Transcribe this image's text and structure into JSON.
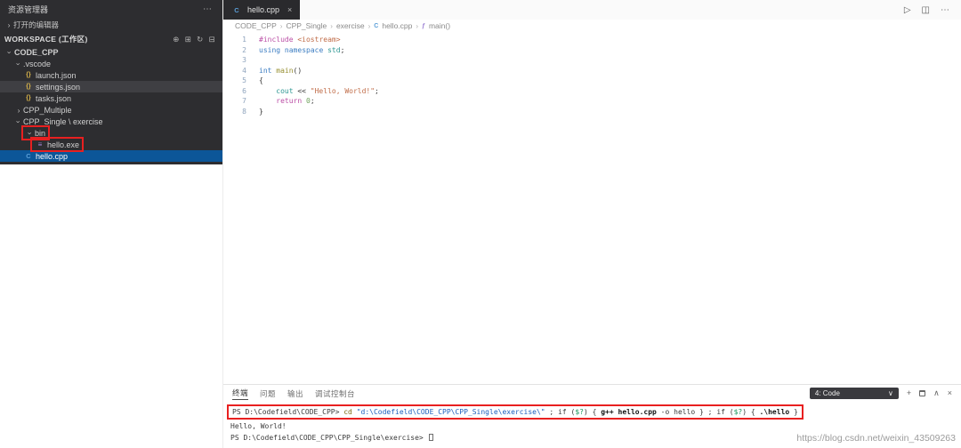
{
  "icons": {
    "more": "⋯",
    "new_file": "⊕",
    "new_folder": "⊞",
    "refresh": "↻",
    "collapse_all": "⊟",
    "chevron_collapsed": "›",
    "run": "▷",
    "split_editor": "◫",
    "close": "×",
    "plus": "+",
    "maximize": "∧",
    "dropdown_chevron": "∨",
    "json_glyph": "{}",
    "cpp_glyph": "C",
    "exe_glyph": "≡",
    "symbol_glyph": "ƒ"
  },
  "colors": {
    "sidebar_bg": "#2d2d30",
    "selection_blue": "#0c5698",
    "selection_gray": "#3f3f43",
    "tab_bg": "#2a2a2d",
    "annotation_red": "#e82020",
    "string_orange": "#c06c48",
    "keyword_pink": "#bb4fa6",
    "keyword_blue": "#3c7dc2"
  },
  "sidebar": {
    "title": "资源管理器",
    "open_editors_label": "打开的编辑器",
    "workspace_label": "WORKSPACE (工作区)",
    "tree": [
      {
        "label": "CODE_CPP",
        "indent": 0,
        "chevron": "down",
        "type": "folder"
      },
      {
        "label": ".vscode",
        "indent": 1,
        "chevron": "down",
        "type": "folder"
      },
      {
        "label": "launch.json",
        "indent": 2,
        "type": "json"
      },
      {
        "label": "settings.json",
        "indent": 2,
        "type": "json",
        "selected": "gray"
      },
      {
        "label": "tasks.json",
        "indent": 2,
        "type": "json"
      },
      {
        "label": "CPP_Multiple",
        "indent": 1,
        "chevron": "right",
        "type": "folder"
      },
      {
        "label": "CPP_Single \\ exercise",
        "indent": 1,
        "chevron": "down",
        "type": "folder"
      },
      {
        "label": "bin",
        "indent": 2,
        "chevron": "down",
        "type": "folder",
        "redbox": true
      },
      {
        "label": "hello.exe",
        "indent": 3,
        "type": "exe",
        "redbox": true
      },
      {
        "label": "hello.cpp",
        "indent": 2,
        "type": "cpp",
        "selected": "blue"
      }
    ]
  },
  "tab": {
    "title": "hello.cpp"
  },
  "breadcrumb": [
    {
      "label": "CODE_CPP"
    },
    {
      "label": "CPP_Single"
    },
    {
      "label": "exercise"
    },
    {
      "label": "hello.cpp",
      "icon": "cpp"
    },
    {
      "label": "main()",
      "icon": "symbol"
    }
  ],
  "code": {
    "lines": [
      {
        "num": "1",
        "tokens": [
          {
            "t": "#include ",
            "c": "pink"
          },
          {
            "t": "<iostream>",
            "c": "orange"
          }
        ]
      },
      {
        "num": "2",
        "tokens": [
          {
            "t": "using",
            "c": "blue"
          },
          {
            "t": " ",
            "c": "fg"
          },
          {
            "t": "namespace",
            "c": "blue"
          },
          {
            "t": " ",
            "c": "fg"
          },
          {
            "t": "std",
            "c": "teal"
          },
          {
            "t": ";",
            "c": "fg"
          }
        ]
      },
      {
        "num": "3",
        "tokens": []
      },
      {
        "num": "4",
        "tokens": [
          {
            "t": "int",
            "c": "blue"
          },
          {
            "t": " ",
            "c": "fg"
          },
          {
            "t": "main",
            "c": "yellow"
          },
          {
            "t": "()",
            "c": "fg"
          }
        ]
      },
      {
        "num": "5",
        "tokens": [
          {
            "t": "{",
            "c": "fg"
          }
        ]
      },
      {
        "num": "6",
        "tokens": [
          {
            "t": "    ",
            "c": "fg"
          },
          {
            "t": "cout",
            "c": "teal"
          },
          {
            "t": " << ",
            "c": "fg"
          },
          {
            "t": "\"Hello, World!\"",
            "c": "orange"
          },
          {
            "t": ";",
            "c": "fg"
          }
        ]
      },
      {
        "num": "7",
        "tokens": [
          {
            "t": "    ",
            "c": "fg"
          },
          {
            "t": "return",
            "c": "pink"
          },
          {
            "t": " ",
            "c": "fg"
          },
          {
            "t": "0",
            "c": "green"
          },
          {
            "t": ";",
            "c": "fg"
          }
        ]
      },
      {
        "num": "8",
        "tokens": [
          {
            "t": "}",
            "c": "fg"
          }
        ]
      }
    ]
  },
  "panel": {
    "tabs": [
      {
        "label": "终端",
        "active": true
      },
      {
        "label": "问题",
        "active": false
      },
      {
        "label": "输出",
        "active": false
      },
      {
        "label": "调试控制台",
        "active": false
      }
    ],
    "shell_selector": "4: Code",
    "terminal_lines": [
      {
        "redbox": true,
        "tokens": [
          {
            "t": "PS D:\\Codefield\\CODE_CPP> ",
            "c": "fg"
          },
          {
            "t": "cd ",
            "c": "cmd"
          },
          {
            "t": "\"d:\\Codefield\\CODE_CPP\\CPP_Single\\exercise\\\"",
            "c": "str2"
          },
          {
            "t": " ; ",
            "c": "fg"
          },
          {
            "t": "if (",
            "c": "fg"
          },
          {
            "t": "$?",
            "c": "var"
          },
          {
            "t": ") { ",
            "c": "fg"
          },
          {
            "t": "g++ hello.cpp",
            "c": "bold"
          },
          {
            "t": " -o hello",
            "c": "fg"
          },
          {
            "t": " } ; ",
            "c": "fg"
          },
          {
            "t": "if (",
            "c": "fg"
          },
          {
            "t": "$?",
            "c": "var"
          },
          {
            "t": ") { ",
            "c": "fg"
          },
          {
            "t": ".\\hello",
            "c": "bold"
          },
          {
            "t": " }",
            "c": "fg"
          }
        ]
      },
      {
        "tokens": [
          {
            "t": "Hello, World!",
            "c": "fg"
          }
        ]
      },
      {
        "cursor": true,
        "tokens": [
          {
            "t": "PS D:\\Codefield\\CODE_CPP\\CPP_Single\\exercise> ",
            "c": "fg"
          }
        ]
      }
    ]
  },
  "watermark": "https://blog.csdn.net/weixin_43509263"
}
